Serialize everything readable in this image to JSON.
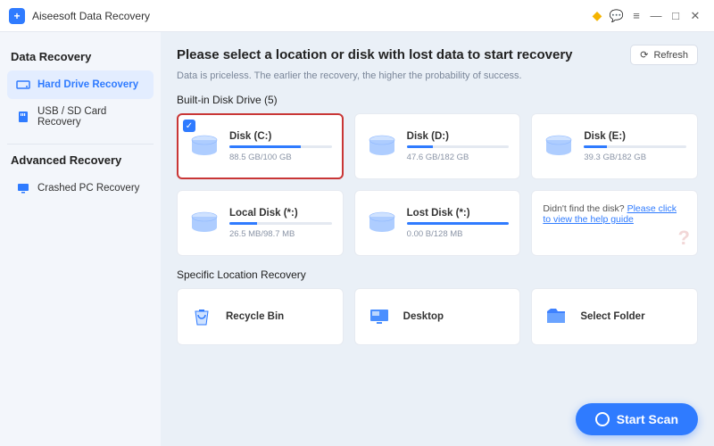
{
  "app": {
    "title": "Aiseesoft Data Recovery"
  },
  "sidebar": {
    "section1": "Data Recovery",
    "items1": [
      {
        "label": "Hard Drive Recovery"
      },
      {
        "label": "USB / SD Card Recovery"
      }
    ],
    "section2": "Advanced Recovery",
    "items2": [
      {
        "label": "Crashed PC Recovery"
      }
    ]
  },
  "main": {
    "title": "Please select a location or disk with lost data to start recovery",
    "subtitle": "Data is priceless. The earlier the recovery, the higher the probability of success.",
    "refresh": "Refresh",
    "group1": "Built-in Disk Drive (5)",
    "disks": [
      {
        "name": "Disk (C:)",
        "size": "88.5 GB/100 GB",
        "pct": 70,
        "selected": true
      },
      {
        "name": "Disk (D:)",
        "size": "47.6 GB/182 GB",
        "pct": 26,
        "selected": false
      },
      {
        "name": "Disk (E:)",
        "size": "39.3 GB/182 GB",
        "pct": 22,
        "selected": false
      },
      {
        "name": "Local Disk (*:)",
        "size": "26.5 MB/98.7 MB",
        "pct": 27,
        "selected": false
      },
      {
        "name": "Lost Disk (*:)",
        "size": "0.00 B/128 MB",
        "pct": 100,
        "selected": false
      }
    ],
    "help": {
      "text": "Didn't find the disk? ",
      "link": "Please click to view the help guide"
    },
    "group2": "Specific Location Recovery",
    "locations": [
      {
        "label": "Recycle Bin"
      },
      {
        "label": "Desktop"
      },
      {
        "label": "Select Folder"
      }
    ],
    "start": "Start Scan"
  }
}
